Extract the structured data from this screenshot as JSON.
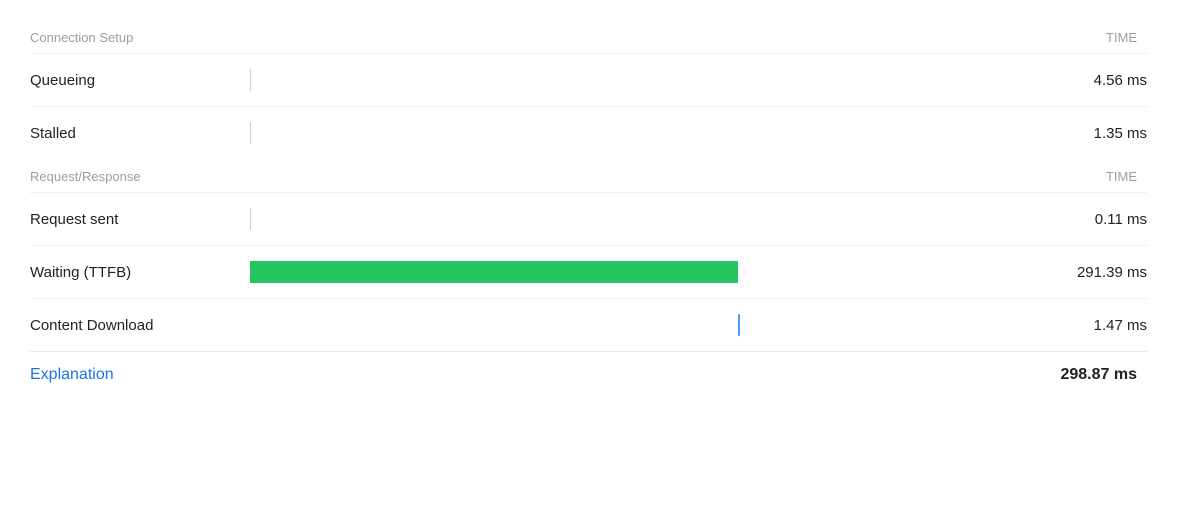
{
  "connection_setup": {
    "section_label": "Connection Setup",
    "time_label": "TIME"
  },
  "request_response": {
    "section_label": "Request/Response",
    "time_label": "TIME"
  },
  "rows": [
    {
      "id": "queueing",
      "label": "Queueing",
      "time": "4.56 ms",
      "bar_type": "tick",
      "bar_position_pct": 0
    },
    {
      "id": "stalled",
      "label": "Stalled",
      "time": "1.35 ms",
      "bar_type": "tick",
      "bar_position_pct": 0
    },
    {
      "id": "request-sent",
      "label": "Request sent",
      "time": "0.11 ms",
      "bar_type": "tick",
      "bar_position_pct": 0
    },
    {
      "id": "waiting-ttfb",
      "label": "Waiting (TTFB)",
      "time": "291.39 ms",
      "bar_type": "green",
      "bar_width_pct": 62,
      "bar_start_pct": 0
    },
    {
      "id": "content-download",
      "label": "Content Download",
      "time": "1.47 ms",
      "bar_type": "blue-tick",
      "bar_position_pct": 62
    }
  ],
  "footer": {
    "explanation_label": "Explanation",
    "total_time": "298.87 ms"
  }
}
